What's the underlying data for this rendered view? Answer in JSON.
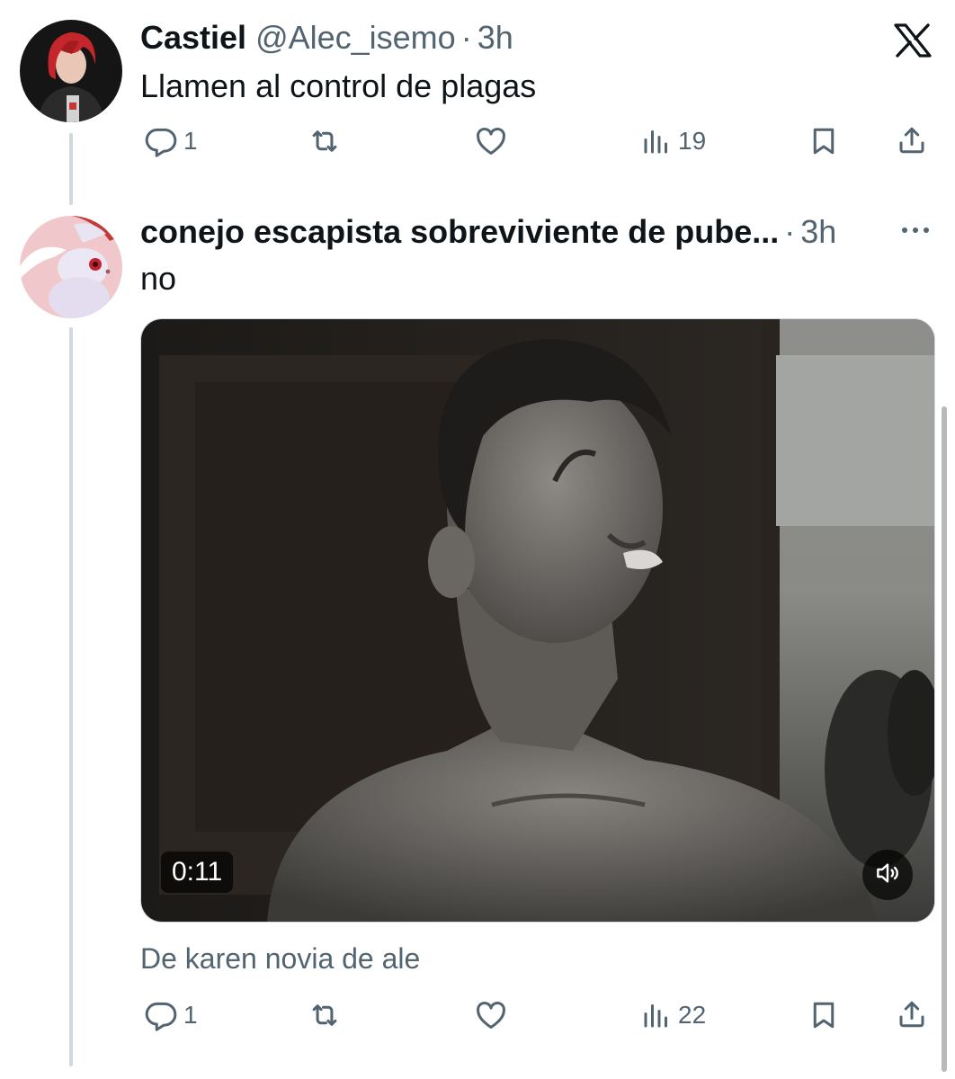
{
  "tweet1": {
    "display_name": "Castiel",
    "handle": "@Alec_isemo",
    "separator": "·",
    "time": "3h",
    "text": "Llamen al control de plagas",
    "actions": {
      "reply_count": "1",
      "repost_count": "",
      "like_count": "",
      "views_count": "19"
    }
  },
  "tweet2": {
    "display_name": "conejo escapista sobreviviente de pube...",
    "separator": "·",
    "time": "3h",
    "text": "no",
    "media": {
      "type": "video",
      "duration": "0:11",
      "volume_icon": "volume-muted-icon"
    },
    "source": "De karen novia de ale",
    "actions": {
      "reply_count": "1",
      "repost_count": "",
      "like_count": "",
      "views_count": "22"
    }
  },
  "icons": {
    "brand": "x-logo-icon",
    "more": "more-horizontal-icon",
    "reply": "reply-icon",
    "repost": "repost-icon",
    "like": "heart-icon",
    "views": "views-chart-icon",
    "bookmark": "bookmark-icon",
    "share": "share-icon"
  },
  "colors": {
    "text_primary": "#0f1419",
    "text_secondary": "#536471",
    "thread_line": "#cfd9de"
  }
}
